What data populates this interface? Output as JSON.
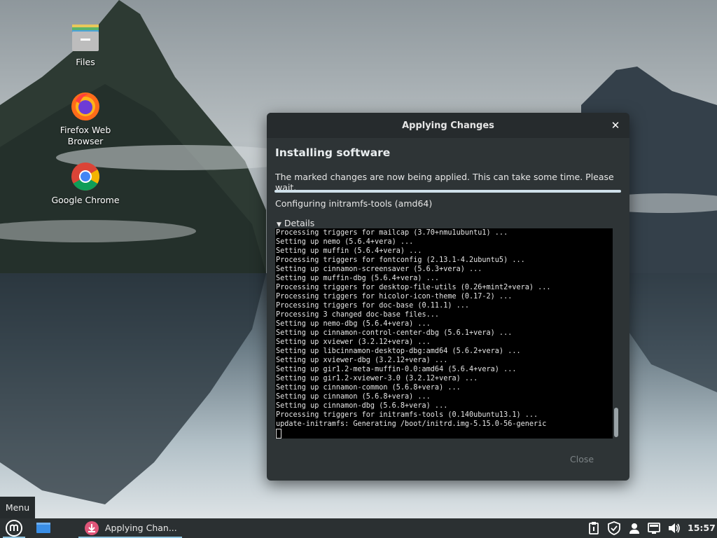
{
  "desktop": {
    "icons": [
      {
        "label": "Files",
        "icon": "folder-icon"
      },
      {
        "label": "Firefox Web\nBrowser",
        "icon": "firefox-icon"
      },
      {
        "label": "Google Chrome",
        "icon": "chrome-icon"
      }
    ]
  },
  "dialog": {
    "title": "Applying Changes",
    "close_glyph": "✕",
    "heading": "Installing software",
    "subtitle": "The marked changes are now being applied. This can take some time. Please wait.",
    "progress_fraction": 1.0,
    "status": "Configuring initramfs-tools (amd64)",
    "details_label": "Details",
    "details_arrow": "▼",
    "terminal_lines": [
      "Processing triggers for mailcap (3.70+nmu1ubuntu1) ...",
      "Setting up nemo (5.6.4+vera) ...",
      "Setting up muffin (5.6.4+vera) ...",
      "Processing triggers for fontconfig (2.13.1-4.2ubuntu5) ...",
      "Setting up cinnamon-screensaver (5.6.3+vera) ...",
      "Setting up muffin-dbg (5.6.4+vera) ...",
      "Processing triggers for desktop-file-utils (0.26+mint2+vera) ...",
      "Processing triggers for hicolor-icon-theme (0.17-2) ...",
      "Processing triggers for doc-base (0.11.1) ...",
      "Processing 3 changed doc-base files...",
      "Setting up nemo-dbg (5.6.4+vera) ...",
      "Setting up cinnamon-control-center-dbg (5.6.1+vera) ...",
      "Setting up xviewer (3.2.12+vera) ...",
      "Setting up libcinnamon-desktop-dbg:amd64 (5.6.2+vera) ...",
      "Setting up xviewer-dbg (3.2.12+vera) ...",
      "Setting up gir1.2-meta-muffin-0.0:amd64 (5.6.4+vera) ...",
      "Setting up gir1.2-xviewer-3.0 (3.2.12+vera) ...",
      "Setting up cinnamon-common (5.6.8+vera) ...",
      "Setting up cinnamon (5.6.8+vera) ...",
      "Setting up cinnamon-dbg (5.6.8+vera) ...",
      "Processing triggers for initramfs-tools (0.140ubuntu13.1) ...",
      "update-initramfs: Generating /boot/initrd.img-5.15.0-56-generic"
    ],
    "close_button": "Close"
  },
  "menu_tooltip": "Menu",
  "taskbar": {
    "task_label": "Applying Chan...",
    "clock": "15:57",
    "accent": "#8fc4e0"
  }
}
